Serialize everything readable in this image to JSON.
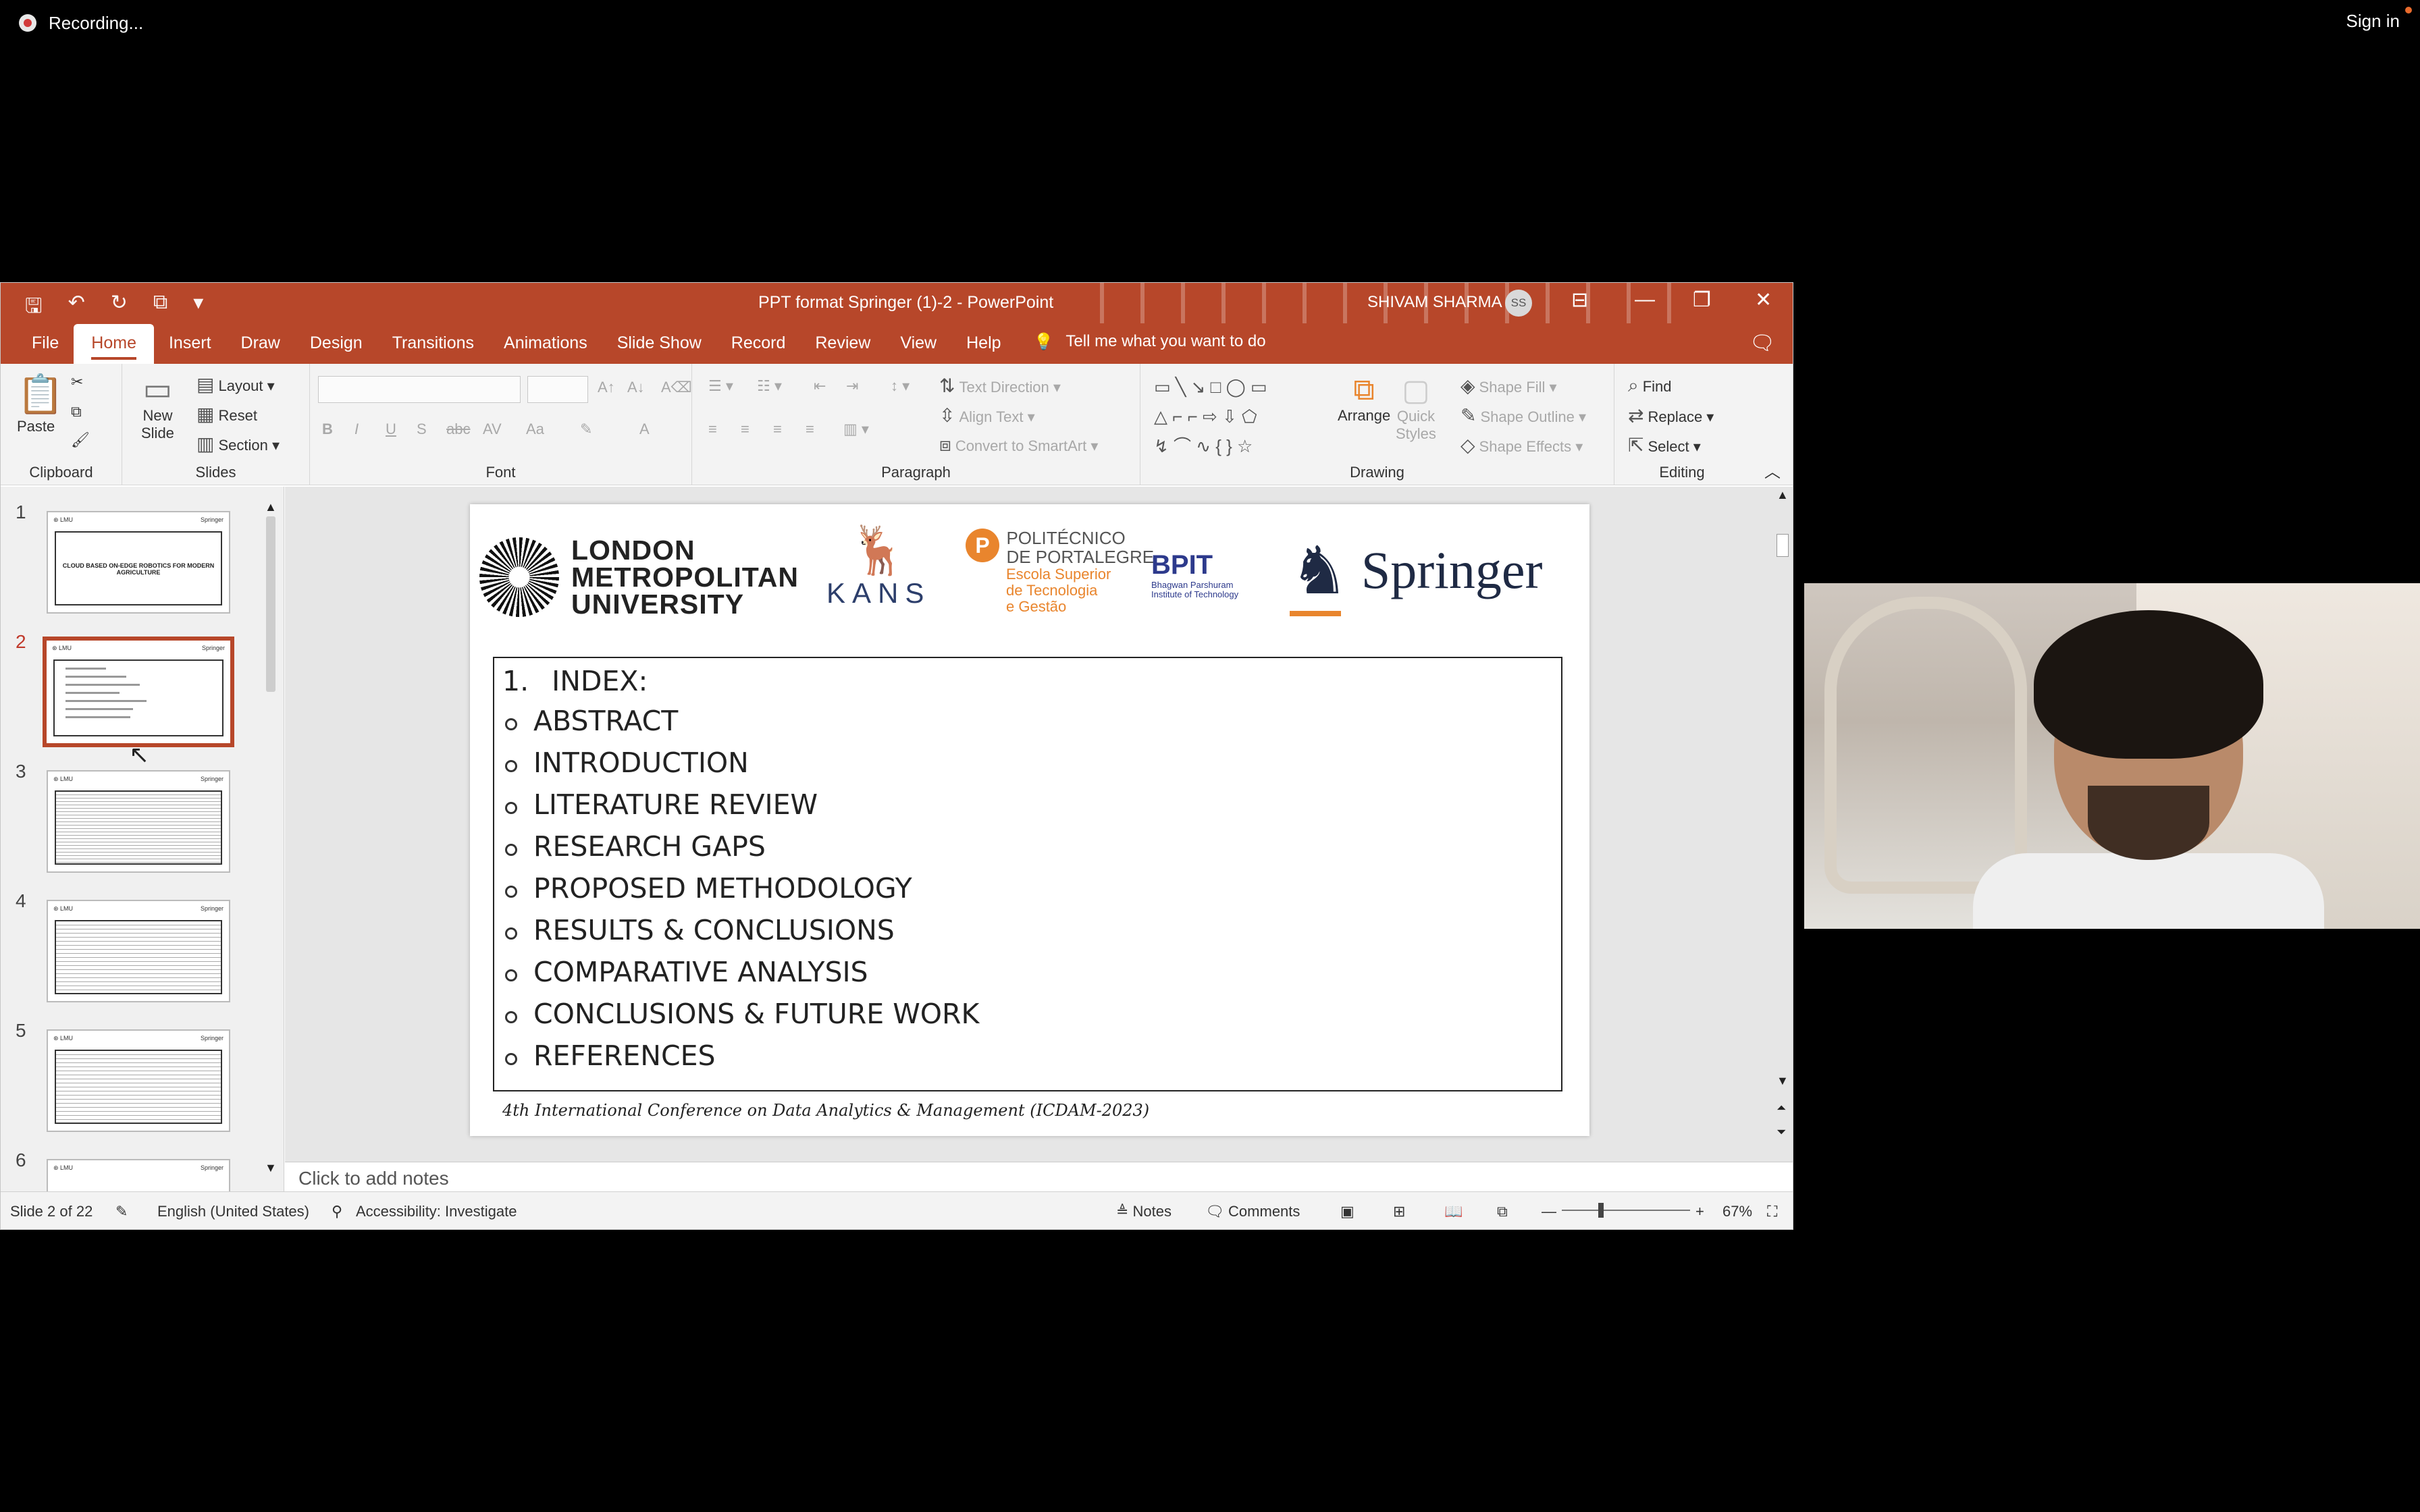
{
  "zoom_bar": {
    "recording": "Recording...",
    "signin": "Sign in"
  },
  "window": {
    "title": "PPT format Springer (1)-2  -  PowerPoint",
    "user": "SHIVAM SHARMA",
    "user_initials": "SS",
    "tell_me": "Tell me what you want to do"
  },
  "tabs": [
    "File",
    "Home",
    "Insert",
    "Draw",
    "Design",
    "Transitions",
    "Animations",
    "Slide Show",
    "Record",
    "Review",
    "View",
    "Help"
  ],
  "ribbon": {
    "clipboard": {
      "label": "Clipboard",
      "paste": "Paste"
    },
    "slides": {
      "label": "Slides",
      "new_slide_1": "New",
      "new_slide_2": "Slide",
      "layout": "Layout",
      "reset": "Reset",
      "section": "Section"
    },
    "font": {
      "label": "Font"
    },
    "paragraph": {
      "label": "Paragraph",
      "text_direction": "Text Direction",
      "align_text": "Align Text",
      "smartart": "Convert to SmartArt"
    },
    "drawing": {
      "label": "Drawing",
      "arrange": "Arrange",
      "quick_1": "Quick",
      "quick_2": "Styles",
      "fill": "Shape Fill",
      "outline": "Shape Outline",
      "effects": "Shape Effects"
    },
    "editing": {
      "label": "Editing",
      "find": "Find",
      "replace": "Replace",
      "select": "Select"
    }
  },
  "thumbnails": [
    "1",
    "2",
    "3",
    "4",
    "5",
    "6"
  ],
  "thumb_text": {
    "thumb1_title": "CLOUD BASED ON-EDGE ROBOTICS FOR MODERN AGRICULTURE"
  },
  "slide": {
    "logos": {
      "lmu": [
        "LONDON",
        "METROPOLITAN",
        "UNIVERSITY"
      ],
      "kans": "KANS",
      "poli_title": [
        "POLITÉCNICO",
        "DE PORTALEGRE"
      ],
      "poli_sub": [
        "Escola Superior",
        "de Tecnologia",
        "e Gestão"
      ],
      "bpit": "BPIT",
      "bpit_sub": [
        "Bhagwan Parshuram",
        "Institute of Technology"
      ],
      "springer": "Springer"
    },
    "index_number": "1.",
    "index_title": "INDEX:",
    "items": [
      "ABSTRACT",
      "INTRODUCTION",
      "LITERATURE REVIEW",
      "RESEARCH GAPS",
      "PROPOSED METHODOLOGY",
      "RESULTS & CONCLUSIONS",
      "COMPARATIVE ANALYSIS",
      "CONCLUSIONS & FUTURE WORK",
      "REFERENCES"
    ],
    "footer": "4th International Conference on Data Analytics & Management (ICDAM-2023)"
  },
  "notes_placeholder": "Click to add notes",
  "status": {
    "slide": "Slide 2 of 22",
    "language": "English (United States)",
    "accessibility": "Accessibility: Investigate",
    "notes": "Notes",
    "comments": "Comments",
    "zoom": "67%"
  },
  "colors": {
    "accent": "#b7472a",
    "orange": "#e9852d",
    "navy": "#1f2a44"
  }
}
